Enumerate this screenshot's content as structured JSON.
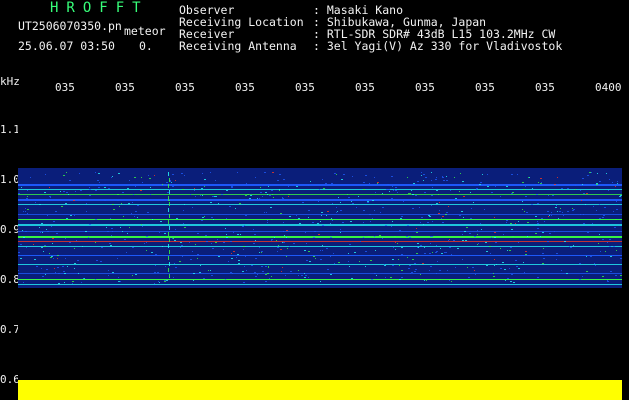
{
  "header": {
    "app_title": "HROFFT",
    "file_name": "UT2506070350.pn",
    "mode": "meteor",
    "date_time": "25.06.07 03:50",
    "meteor_count": "0.",
    "observer_label": "Observer",
    "observer_value": ": Masaki Kano",
    "location_label": "Receiving Location",
    "location_value": ": Shibukawa, Gunma, Japan",
    "receiver_label": "Receiver",
    "receiver_value": ": RTL-SDR SDR# 43dB L15 103.2MHz CW",
    "antenna_label": "Receiving Antenna",
    "antenna_value": ": 3el Yagi(V) Az 330 for Vladivostok"
  },
  "axis": {
    "unit": "kHz",
    "y_ticks": [
      "1.1",
      "1.0",
      "0.9",
      "0.8",
      "0.7",
      "0.6"
    ],
    "x_ticks": [
      "035",
      "035",
      "035",
      "035",
      "035",
      "035",
      "035",
      "035",
      "035",
      "0400"
    ]
  },
  "colors": {
    "background": "#000000",
    "header_text": "#f2f2f2",
    "title_green": "#37ff7a",
    "yellow": "#ffff00",
    "spectrogram_dark": "#0a1e7a",
    "spectrogram_mid": "#1f5cff",
    "spectrogram_cyan": "#25ffff",
    "spectrogram_green": "#39ff42",
    "spectrogram_red": "#ff3a1f"
  }
}
